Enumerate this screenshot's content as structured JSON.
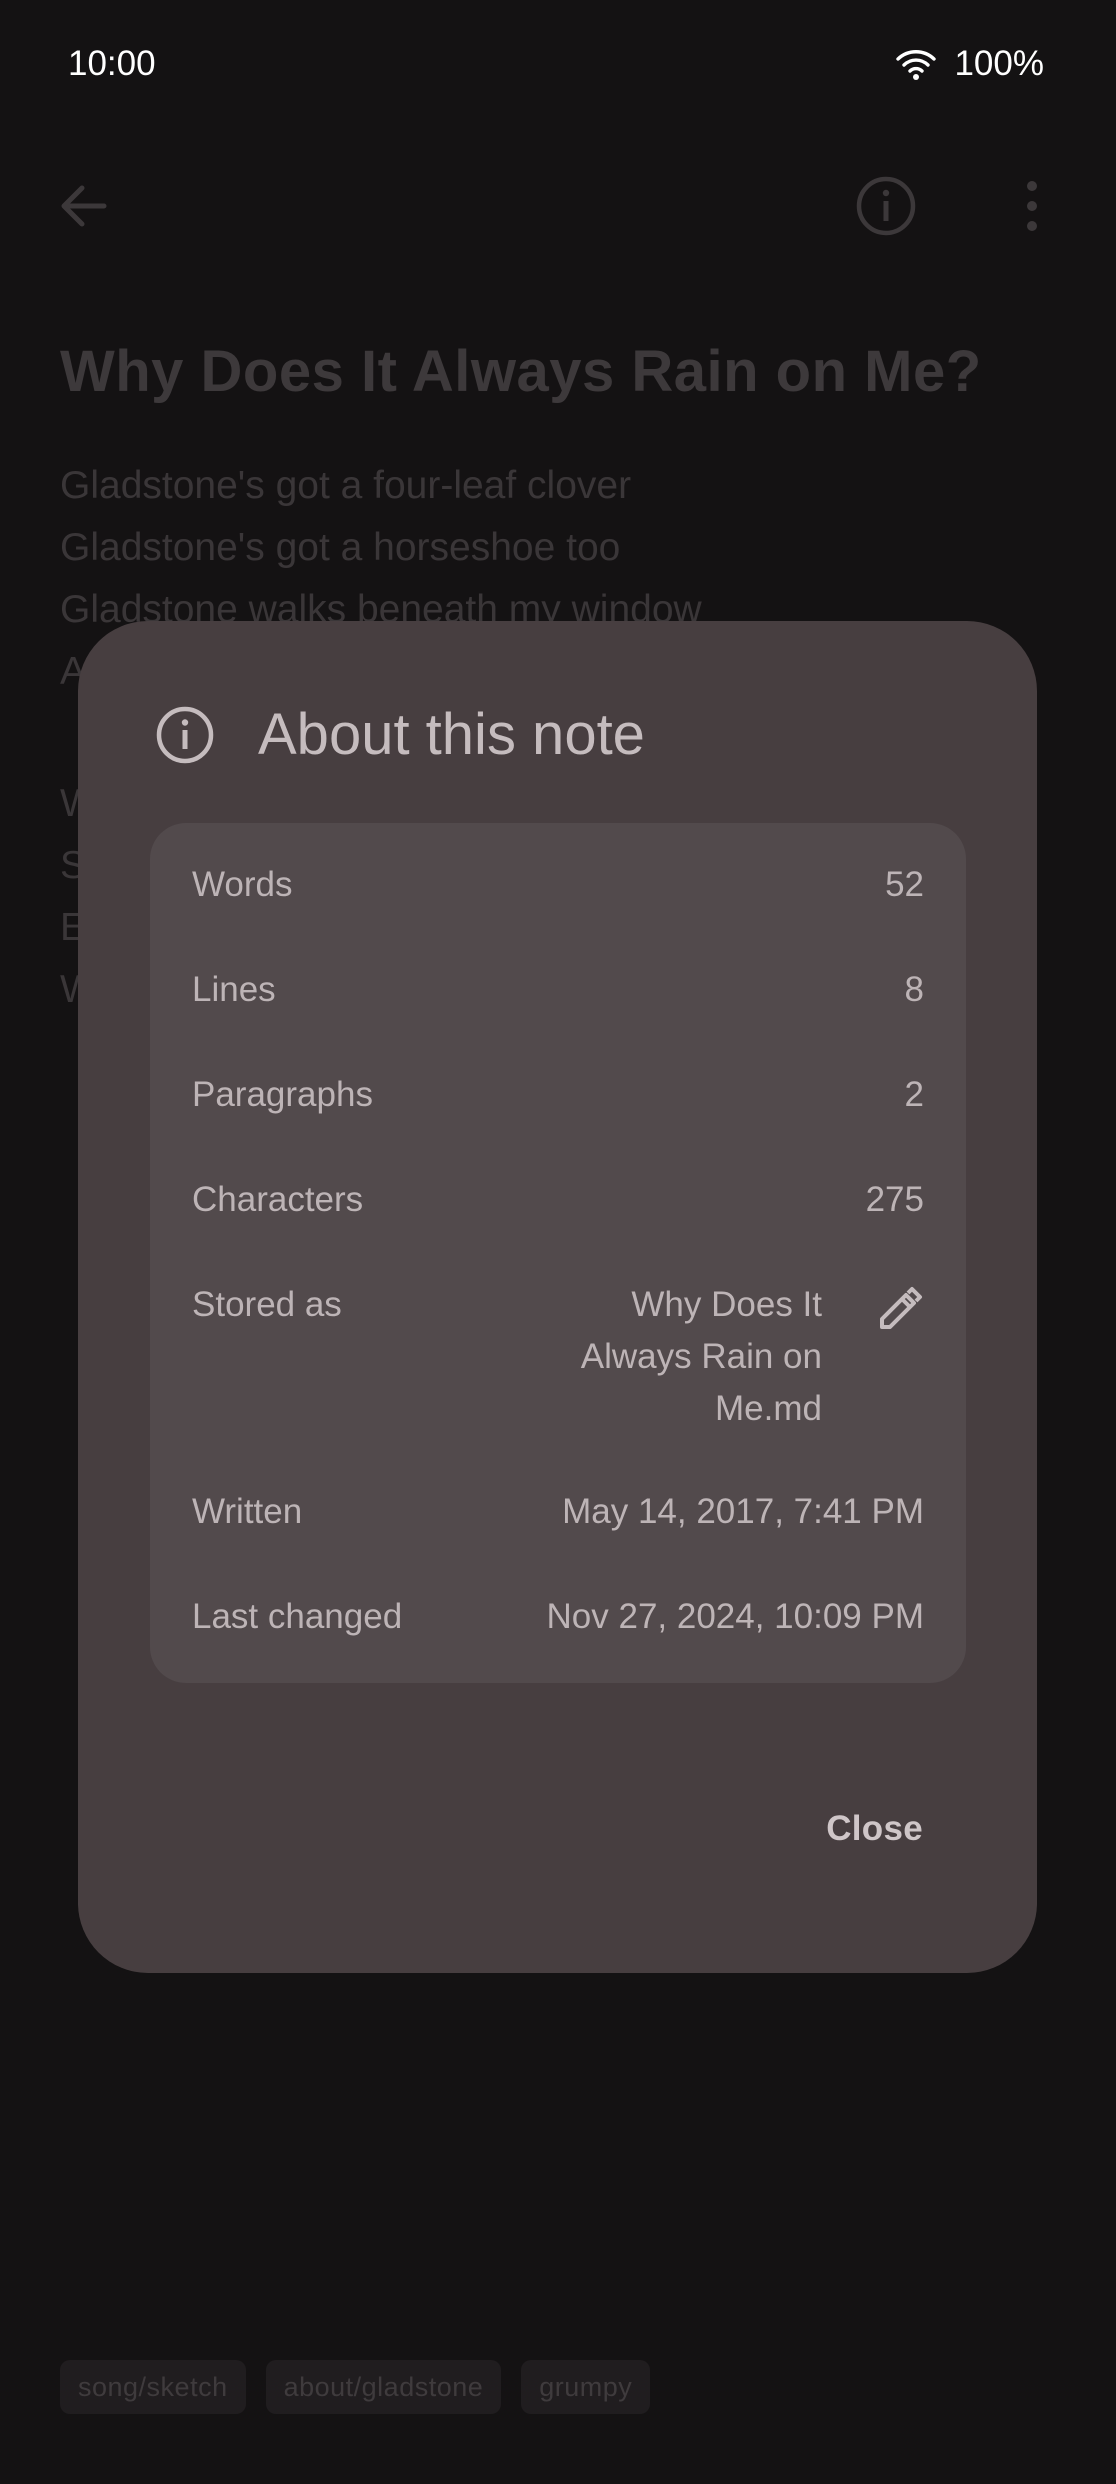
{
  "status_bar": {
    "time": "10:00",
    "battery": "100%"
  },
  "note": {
    "title": "Why Does It Always Rain on Me?",
    "lines": [
      "Gladstone's got a four-leaf clover",
      "Gladstone's got a horseshoe too",
      "Gladstone walks beneath my window",
      "A",
      "W",
      "S",
      "E",
      "W"
    ]
  },
  "tags": [
    "song/sketch",
    "about/gladstone",
    "grumpy"
  ],
  "dialog": {
    "title": "About this note",
    "rows": {
      "words": {
        "label": "Words",
        "value": "52"
      },
      "lines": {
        "label": "Lines",
        "value": "8"
      },
      "paragraphs": {
        "label": "Paragraphs",
        "value": "2"
      },
      "characters": {
        "label": "Characters",
        "value": "275"
      },
      "stored_as": {
        "label": "Stored as",
        "value": "Why Does It Always Rain on Me.md"
      },
      "written": {
        "label": "Written",
        "value": "May 14, 2017, 7:41 PM"
      },
      "last_changed": {
        "label": "Last changed",
        "value": "Nov 27, 2024, 10:09 PM"
      }
    },
    "close_label": "Close"
  },
  "icons": {
    "back": "arrow-back-icon",
    "info": "info-icon",
    "more": "more-vert-icon",
    "edit": "pencil-icon",
    "wifi": "wifi-icon"
  }
}
